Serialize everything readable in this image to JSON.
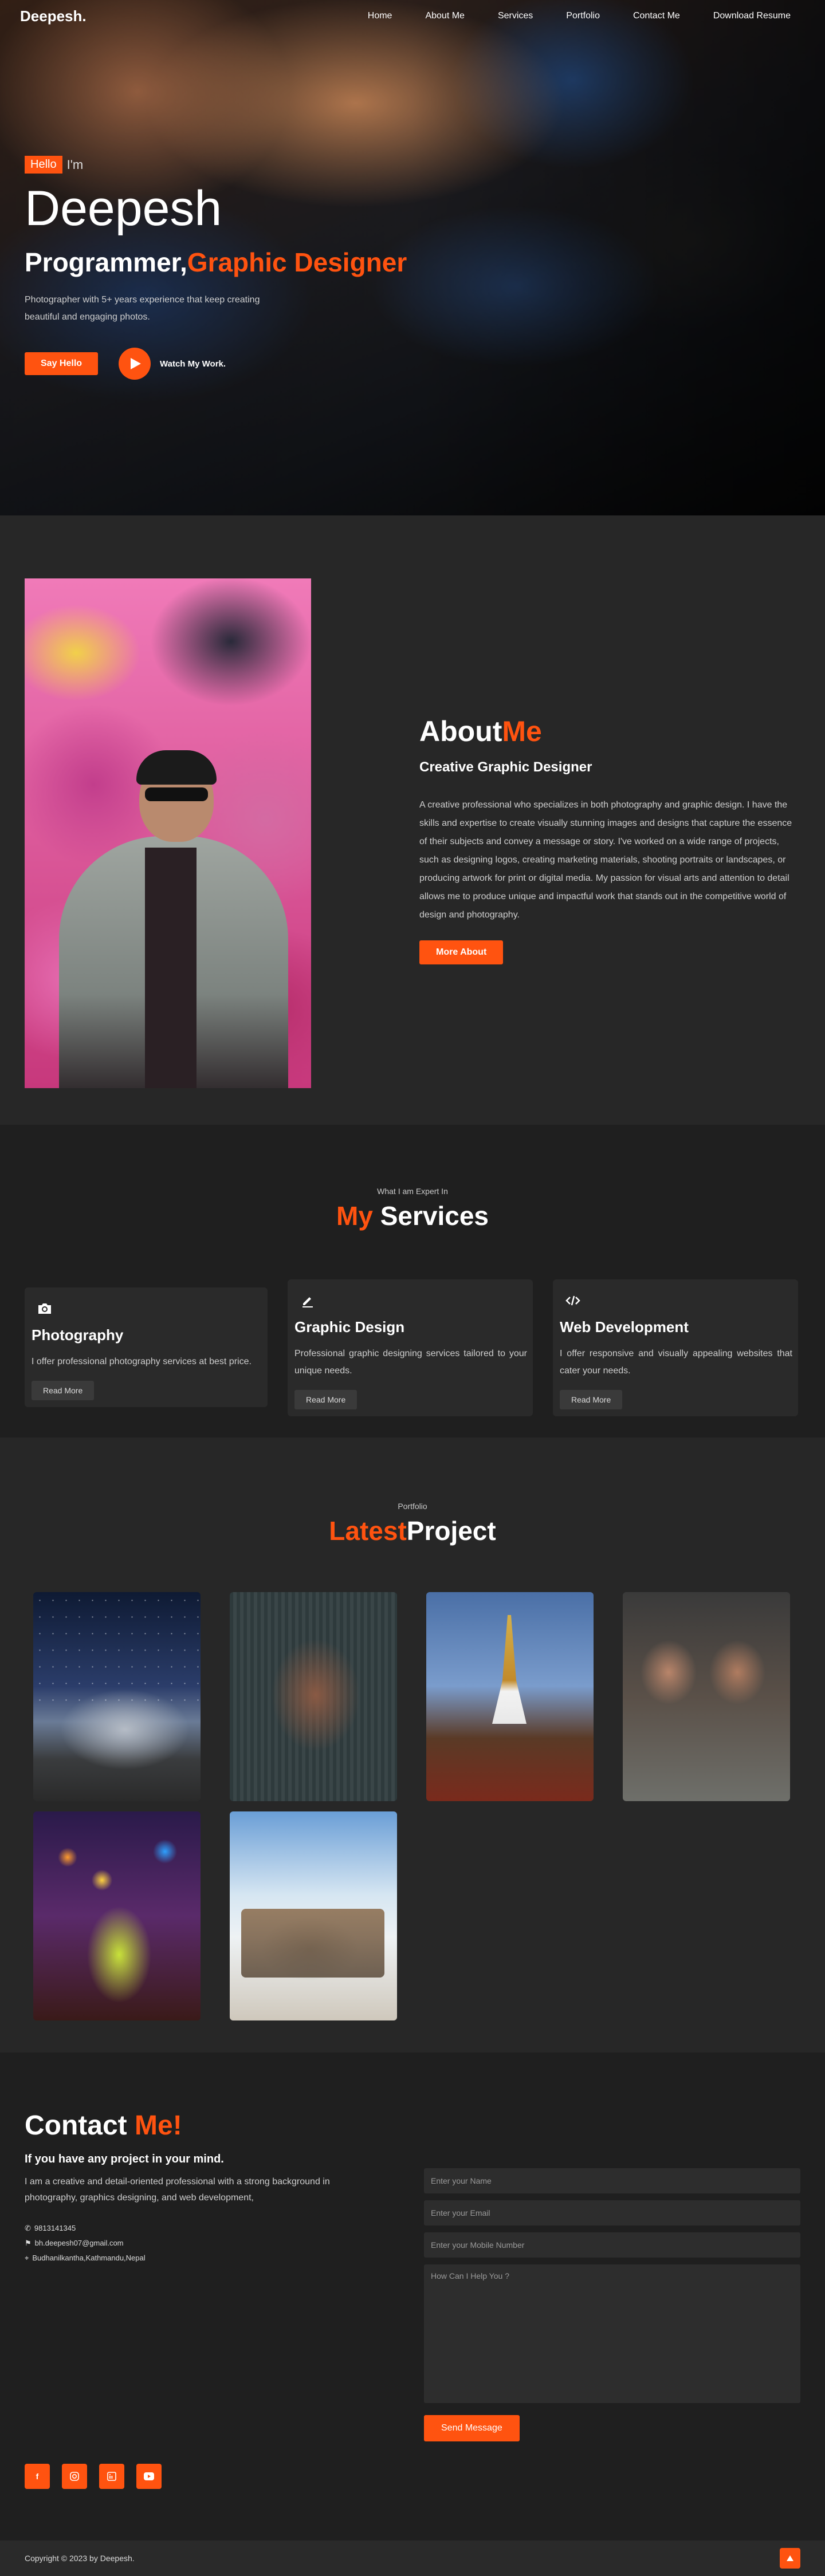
{
  "nav": {
    "logo": "Deepesh.",
    "links": [
      "Home",
      "About Me",
      "Services",
      "Portfolio",
      "Contact Me",
      "Download Resume"
    ]
  },
  "hero": {
    "hello": "Hello",
    "im": "I'm",
    "name": "Deepesh",
    "role_plain": "Programmer,",
    "role_accent": "Graphic Designer",
    "description": "Photographer with 5+ years experience that keep creating beautiful and engaging photos.",
    "say_hello": "Say Hello",
    "watch": "Watch My Work."
  },
  "about": {
    "title_plain": "About",
    "title_accent": "Me",
    "subtitle": "Creative Graphic Designer",
    "paragraph": "A creative professional who specializes in both photography and graphic design. I have the skills and expertise to create visually stunning images and designs that capture the essence of their subjects and convey a message or story. I've worked on a wide range of projects, such as designing logos, creating marketing materials, shooting portraits or landscapes, or producing artwork for print or digital media. My passion for visual arts and attention to detail allows me to produce unique and impactful work that stands out in the competitive world of design and photography.",
    "button": "More About"
  },
  "services": {
    "kicker": "What I am Expert In",
    "title_accent": "My",
    "title_plain": "Services",
    "cards": [
      {
        "icon": "camera-icon",
        "title": "Photography",
        "desc": "I offer professional photography services at best price.",
        "button": "Read More"
      },
      {
        "icon": "pen-icon",
        "title": "Graphic Design",
        "desc": "Professional graphic designing services tailored to your unique needs.",
        "button": "Read More"
      },
      {
        "icon": "code-icon",
        "title": "Web Development",
        "desc": "I offer responsive and visually appealing websites that cater your needs.",
        "button": "Read More"
      }
    ]
  },
  "portfolio": {
    "kicker": "Portfolio",
    "title_accent": "Latest",
    "title_plain": "Project"
  },
  "contact": {
    "title_plain": "Contact",
    "title_accent": "Me!",
    "subtitle": "If you have any project in your mind.",
    "paragraph": "I am a creative and detail-oriented professional with a strong background in photography, graphics designing, and web development,",
    "phone": "9813141345",
    "email": "bh.deepesh07@gmail.com",
    "address": "Budhanilkantha,Kathmandu,Nepal",
    "placeholders": {
      "name": "Enter your Name",
      "email": "Enter your Email",
      "mobile": "Enter your Mobile Number",
      "message": "How Can I Help You ?"
    },
    "send": "Send Message",
    "socials": [
      "facebook-icon",
      "instagram-icon",
      "linkedin-icon",
      "youtube-icon"
    ]
  },
  "footer": {
    "copyright": "Copyright © 2023 by Deepesh."
  },
  "colors": {
    "accent": "#ff5310",
    "background": "#202020"
  }
}
